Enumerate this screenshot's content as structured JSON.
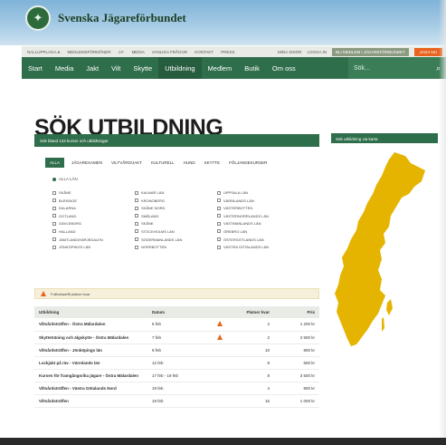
{
  "site": {
    "logo_icon": "deer-emblem-icon",
    "name": "Svenska Jägareförbundet"
  },
  "utility_bar": {
    "links": [
      "NALLUPPLAGA &",
      "MEDLEMSFÖRMÅNER",
      "J.F.",
      "MEDIA",
      "VANLIGA FRÅGOR",
      "KONTAKT",
      "PRESS"
    ],
    "right_links": [
      "MINA SIDOR",
      "LOGGA IN"
    ],
    "login_button": "BLI MEDLEM i JÄGAREFÖRBUNDET",
    "orange_button": "JAGA NU"
  },
  "main_nav": {
    "items": [
      "Start",
      "Media",
      "Jakt",
      "Vilt",
      "Skytte",
      "Utbildning",
      "Medlem",
      "Butik",
      "Om oss"
    ],
    "active": "Utbildning",
    "search_placeholder": "Sök...",
    "search_icon": "search-icon"
  },
  "page": {
    "title": "SÖK UTBILDNING"
  },
  "search_panel": {
    "header": "Sök bland 134 kurser och utbildningar",
    "tabs": [
      "ALLA",
      "JÄGAREXAMEN",
      "VILTVÅRD/JAKT",
      "KULTURELL",
      "HUND",
      "SKYTTE",
      "FÖLJANDEKURSER"
    ],
    "active_tab": "ALLA",
    "all_regions_label": "ALLA LÄN",
    "regions": [
      "SKÅNE",
      "KALMAR LÄN",
      "UPPSALA LÄN",
      "BLEKINGE",
      "KRONOBERG",
      "VÄRMLANDS LÄN",
      "DALARNA",
      "SKÅNE NORD",
      "VÄSTERBOTTEN",
      "GOTLAND",
      "SMÅLAND",
      "VÄSTERNORRLANDS LÄN",
      "GÄVLEBORG",
      "SKÅNE",
      "VÄSTMANLANDS LÄN",
      "HALLAND",
      "STOCKHOLMS LÄN",
      "ÖREBRO LÄN",
      "JÄMTLAND/HÄRJEDALEN",
      "SÖDERMANLANDS LÄN",
      "ÖSTERGÖTLANDS LÄN",
      "JÖNKÖPINGS LÄN",
      "NORRBOTTEN",
      "VÄSTRA GÖTALANDS LÄN"
    ]
  },
  "notice": {
    "icon": "warning-icon",
    "text": "Fullbokad/få platser kvar"
  },
  "table": {
    "headers": [
      "Utbildning",
      "Datum",
      "",
      "Platser kvar",
      "Pris"
    ],
    "rows": [
      {
        "name": "Viltvårdsträffen - Östra Mälardalen",
        "date": "5 feb",
        "warn": true,
        "seats": "2",
        "price": "1 200 kr"
      },
      {
        "name": "Skytteträning och älgskytte - Östra Mälardalen",
        "date": "7 feb",
        "warn": true,
        "seats": "2",
        "price": "2 500 kr"
      },
      {
        "name": "Viltvårdsträffen - Jönköpings län",
        "date": "9 feb",
        "warn": false,
        "seats": "10",
        "price": "800 kr"
      },
      {
        "name": "Lockjakt på räv - Värmlands län",
        "date": "12 feb",
        "warn": false,
        "seats": "8",
        "price": "600 kr"
      },
      {
        "name": "Kursen för framgångsrika jägare - Östra Mälardalen",
        "date": "17 feb - 19 feb",
        "warn": false,
        "seats": "8",
        "price": "3 500 kr"
      },
      {
        "name": "Viltvårdsträffen - Västra Götalands Nord",
        "date": "19 feb",
        "warn": false,
        "seats": "4",
        "price": "800 kr"
      },
      {
        "name": "Viltvårdsträffen",
        "date": "19 feb",
        "warn": false,
        "seats": "15",
        "price": "1 000 kr"
      }
    ]
  },
  "sidebar": {
    "header": "Sök utbildning via karta",
    "map_icon": "sweden-map",
    "map_color": "#e5b400"
  },
  "colors": {
    "nav_green": "#2f6e4b",
    "accent_orange": "#e8641e",
    "map_yellow": "#e5b400"
  }
}
